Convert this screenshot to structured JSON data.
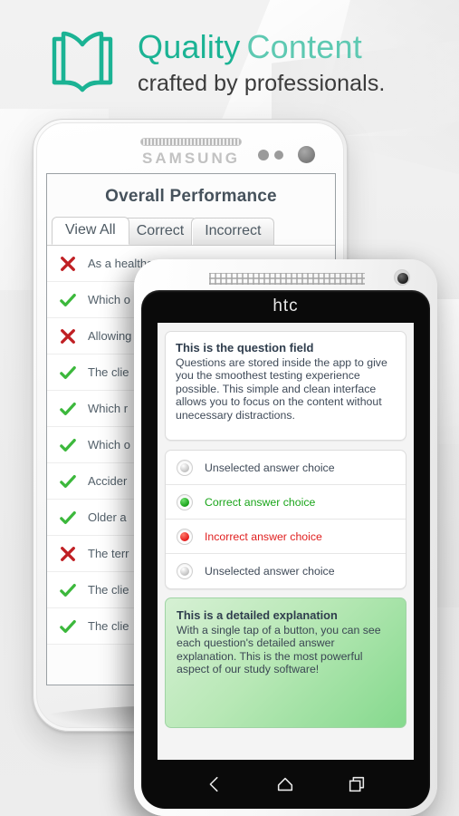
{
  "header": {
    "icon": "open-book-icon",
    "title_bold": "Quality",
    "title_light": "Content",
    "subtitle": "crafted by professionals.",
    "accent_color": "#1bb394",
    "accent_light_color": "#5ec9b2"
  },
  "samsung_phone": {
    "brand": "SAMSUNG",
    "app": {
      "title": "Overall Performance",
      "tabs": [
        {
          "label": "View All",
          "active": true
        },
        {
          "label": "Correct",
          "active": false
        },
        {
          "label": "Incorrect",
          "active": false
        }
      ],
      "rows": [
        {
          "mark": "cross-icon",
          "text": "As a healthc"
        },
        {
          "mark": "check-icon",
          "text": "Which o"
        },
        {
          "mark": "cross-icon",
          "text": "Allowing"
        },
        {
          "mark": "check-icon",
          "text": "The clie"
        },
        {
          "mark": "check-icon",
          "text": "Which r"
        },
        {
          "mark": "check-icon",
          "text": "Which o"
        },
        {
          "mark": "check-icon",
          "text": "Accider"
        },
        {
          "mark": "check-icon",
          "text": "Older a"
        },
        {
          "mark": "cross-icon",
          "text": "The terr"
        },
        {
          "mark": "check-icon",
          "text": "The clie"
        },
        {
          "mark": "check-icon",
          "text": "The clie"
        }
      ]
    }
  },
  "htc_phone": {
    "brand": "htc",
    "app": {
      "question": {
        "title": "This is the question field",
        "body": "Questions are stored inside the app to give you the smoothest testing experience possible. This simple and clean interface allows you to focus on the content without unecessary distractions."
      },
      "choices": [
        {
          "state": "unselected",
          "label": "Unselected answer choice"
        },
        {
          "state": "correct",
          "label": "Correct answer choice"
        },
        {
          "state": "incorrect",
          "label": "Incorrect answer choice"
        },
        {
          "state": "unselected",
          "label": "Unselected answer choice"
        }
      ],
      "explanation": {
        "title": "This is a detailed explanation",
        "body": "With a single tap of a button, you can see each question's detailed answer explanation. This is the most powerful aspect of our study software!"
      }
    },
    "nav": [
      {
        "icon": "back-icon"
      },
      {
        "icon": "home-icon"
      },
      {
        "icon": "recent-apps-icon"
      }
    ]
  },
  "colors": {
    "correct_green": "#1aa51a",
    "incorrect_red": "#e02020",
    "explanation_green": "#85d98d"
  }
}
